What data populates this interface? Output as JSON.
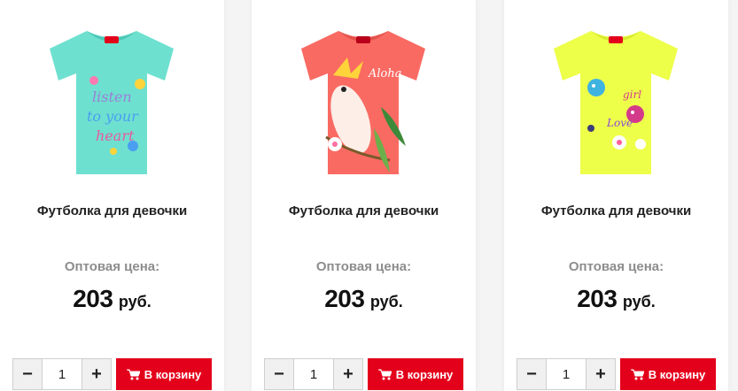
{
  "colors": {
    "accent": "#e3001b",
    "price_label": "#8d8d8d"
  },
  "products": [
    {
      "name": "Футболка для девочки",
      "price_label": "Оптовая цена:",
      "price_value": "203",
      "currency": "руб.",
      "quantity": "1",
      "cart_label": "В корзину",
      "shirt_color": "#6ee0cf",
      "print_text_1": "listen",
      "print_text_2": "to your",
      "print_text_3": "heart"
    },
    {
      "name": "Футболка для девочки",
      "price_label": "Оптовая цена:",
      "price_value": "203",
      "currency": "руб.",
      "quantity": "1",
      "cart_label": "В корзину",
      "shirt_color": "#f96a63",
      "print_text_1": "Aloha"
    },
    {
      "name": "Футболка для девочки",
      "price_label": "Оптовая цена:",
      "price_value": "203",
      "currency": "руб.",
      "quantity": "1",
      "cart_label": "В корзину",
      "shirt_color": "#eeff4a",
      "print_text_1": "girl",
      "print_text_2": "Love"
    }
  ]
}
